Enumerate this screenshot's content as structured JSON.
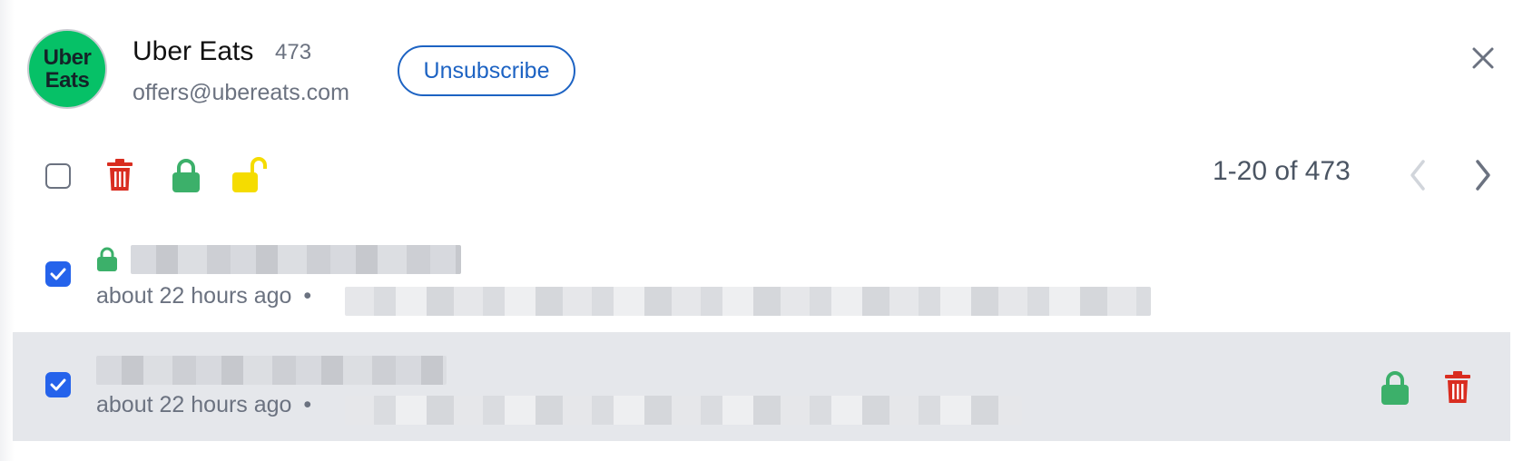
{
  "header": {
    "avatar_line1": "Uber",
    "avatar_line2": "Eats",
    "sender_name": "Uber Eats",
    "count": "473",
    "email": "offers@ubereats.com",
    "unsubscribe_label": "Unsubscribe",
    "close_icon": "close-icon"
  },
  "toolbar": {
    "icons": [
      "select-all-checkbox",
      "trash-icon",
      "lock-icon",
      "unlock-icon"
    ],
    "colors": {
      "trash": "#d92d20",
      "lock": "#3cb06a",
      "unlock": "#f5dc00"
    },
    "pagination_text": "1-20 of 473",
    "prev_icon": "chevron-left-icon",
    "next_icon": "chevron-right-icon"
  },
  "rows": [
    {
      "time": "about 22 hours ago",
      "separator": "•",
      "checked": true,
      "locked": true
    },
    {
      "time": "about 22 hours ago",
      "separator": "•",
      "checked": true,
      "selected": true
    }
  ],
  "colors": {
    "accent": "#2563eb",
    "link": "#1d63c3",
    "selected_row": "#e5e7eb"
  }
}
